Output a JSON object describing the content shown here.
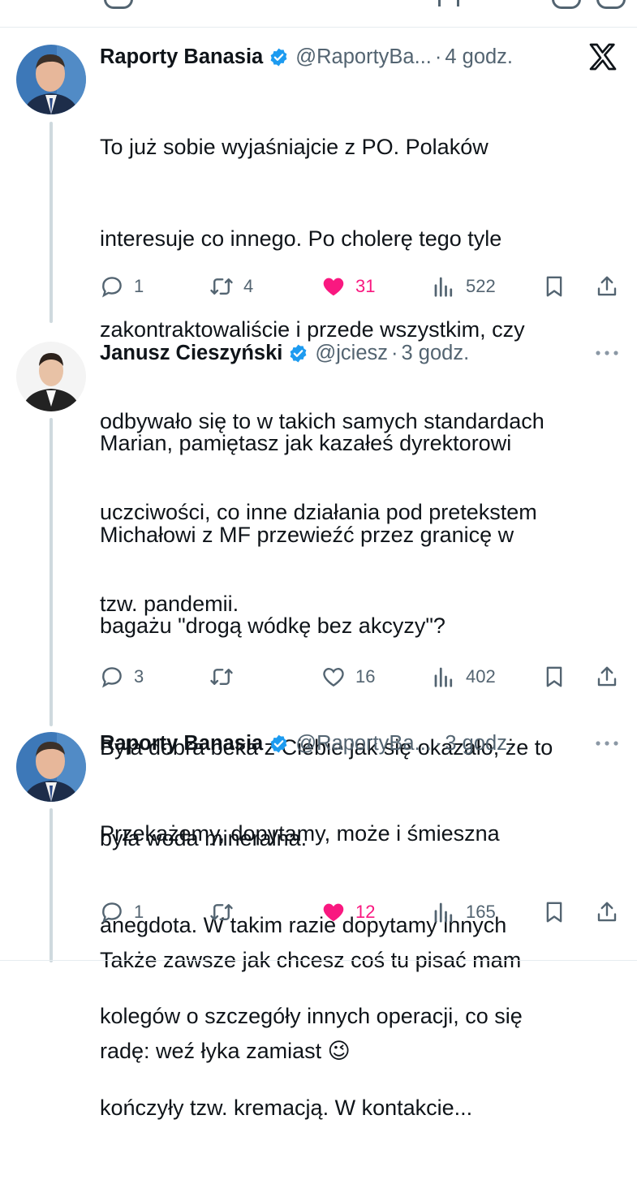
{
  "tweets": [
    {
      "name": "Raporty Banasia",
      "handle": "@RaportyBa...",
      "time": "4 godz.",
      "text_lines": [
        "To już sobie wyjaśniajcie z PO. Polaków",
        "interesuje co innego. Po cholerę tego tyle",
        "zakontraktowaliście i przede wszystkim, czy",
        "odbywało się to w takich samych standardach",
        "uczciwości, co inne działania pod pretekstem",
        "tzw. pandemii."
      ],
      "replies": "1",
      "retweets": "4",
      "likes": "31",
      "views": "522",
      "liked": true,
      "corner_icon": "x-logo-icon"
    },
    {
      "name": "Janusz Cieszyński",
      "handle": "@jciesz",
      "time": "3 godz.",
      "paragraphs": [
        [
          "Marian, pamiętasz jak kazałeś dyrektorowi",
          "Michałowi z MF przewieźć przez granicę w",
          "bagażu \"drogą wódkę bez akcyzy\"?"
        ],
        [
          "Była dobra beka z Ciebie jak się okazało, że to",
          "była woda mineralna."
        ],
        [
          "Także zawsze jak chcesz coś tu pisać mam",
          "radę: weź łyka zamiast 😉"
        ]
      ],
      "replies": "3",
      "retweets": "",
      "likes": "16",
      "views": "402",
      "liked": false,
      "corner_icon": "more-dots-icon"
    },
    {
      "name": "Raporty Banasia",
      "handle": "@RaportyBa...",
      "time": "3 godz.",
      "text_lines": [
        "Przekażemy, dopytamy, może i śmieszna",
        "anegdota. W takim razie dopytamy innych",
        "kolegów o szczegóły innych operacji, co się",
        "kończyły tzw. kremacją. W kontakcie..."
      ],
      "replies": "1",
      "retweets": "",
      "likes": "12",
      "views": "165",
      "liked": true,
      "corner_icon": "more-dots-icon"
    }
  ],
  "colors": {
    "text": "#0f1419",
    "secondary": "#536471",
    "like": "#f91880",
    "verified": "#1d9bf0",
    "thread": "#cfd9de"
  },
  "symbols": {
    "dot": "·",
    "more": "···"
  }
}
